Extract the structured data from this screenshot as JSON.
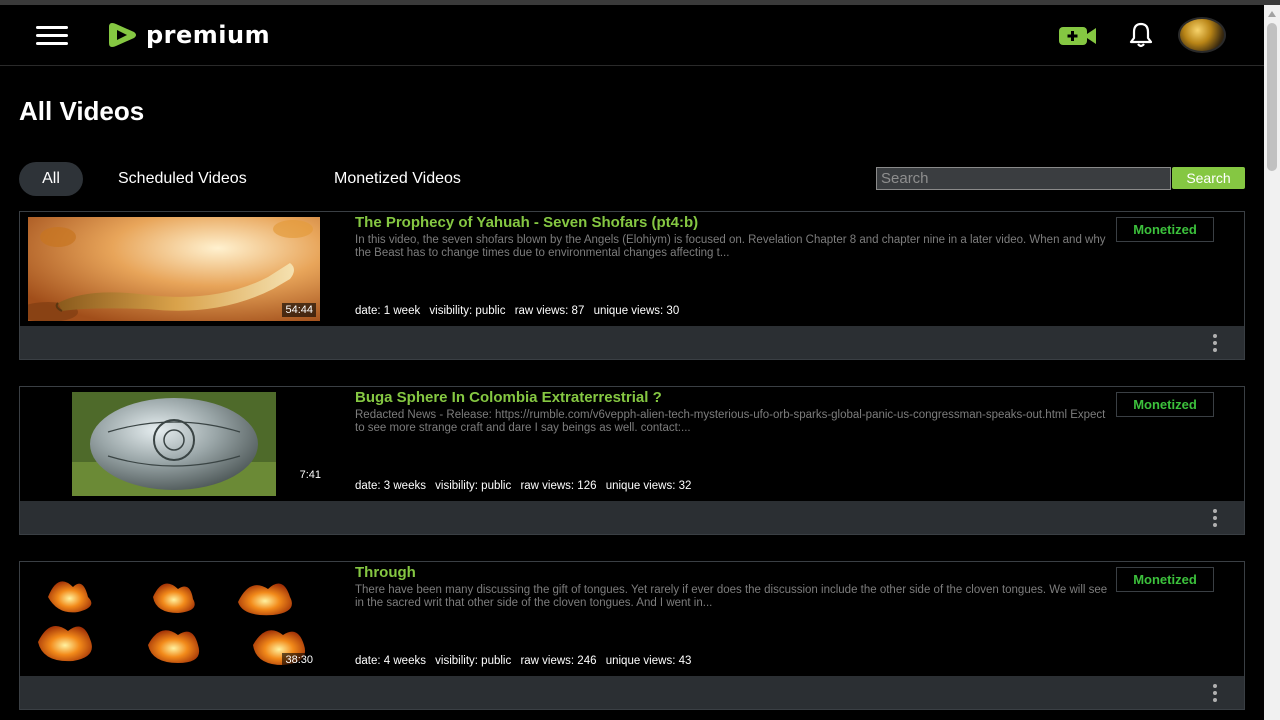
{
  "header": {
    "logo_text": "premium",
    "brand_color": "#85c742"
  },
  "page": {
    "title": "All Videos"
  },
  "tabs": [
    {
      "label": "All",
      "active": true
    },
    {
      "label": "Scheduled Videos",
      "active": false
    },
    {
      "label": "Monetized Videos",
      "active": false
    }
  ],
  "search": {
    "placeholder": "Search",
    "button_label": "Search"
  },
  "videos": [
    {
      "title": "The Prophecy of Yahuah - Seven Shofars (pt4:b)",
      "description": "In this video, the seven shofars blown by the Angels (Elohiym) is focused on. Revelation Chapter 8 and chapter nine in a later video. When and why the Beast has to change times due to environmental changes affecting t...",
      "duration": "54:44",
      "date": "date: 1 week",
      "visibility": "visibility: public",
      "raw_views": "raw views: 87",
      "unique_views": "unique views: 30",
      "badge": "Monetized"
    },
    {
      "title": "Buga Sphere In Colombia Extraterrestrial ?",
      "description": "Redacted News - Release: https://rumble.com/v6vepph-alien-tech-mysterious-ufo-orb-sparks-global-panic-us-congressman-speaks-out.html Expect to see more strange craft and dare I say beings as well. contact:...",
      "duration": "7:41",
      "date": "date: 3 weeks",
      "visibility": "visibility: public",
      "raw_views": "raw views: 126",
      "unique_views": "unique views: 32",
      "badge": "Monetized"
    },
    {
      "title": "Through",
      "description": "There have been many discussing the gift of tongues. Yet rarely if ever does the discussion include the other side of the cloven tongues. We will see in the sacred writ that other side of the cloven tongues. And I went in...",
      "duration": "38:30",
      "date": "date: 4 weeks",
      "visibility": "visibility: public",
      "raw_views": "raw views: 246",
      "unique_views": "unique views: 43",
      "badge": "Monetized"
    }
  ],
  "icons": {
    "menu": "hamburger-menu-icon",
    "upload": "video-camera-plus-icon",
    "notifications": "bell-icon",
    "more": "kebab-menu-icon"
  }
}
